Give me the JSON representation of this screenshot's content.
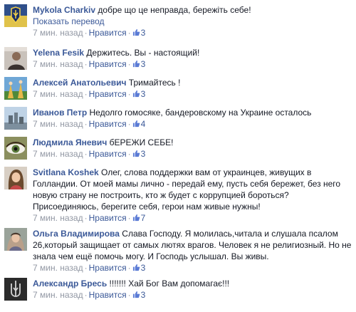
{
  "comments": [
    {
      "author": "Mykola Charkiv",
      "text": "добре що це неправда, бережіть себе!",
      "translate": "Показать перевод",
      "time": "7 мин. назад",
      "like": "Нравится",
      "count": "3"
    },
    {
      "author": "Yelena Fesik",
      "text": "Держитесь. Вы - настоящий!",
      "time": "7 мин. назад",
      "like": "Нравится",
      "count": "3"
    },
    {
      "author": "Алексей Анатольевич",
      "text": "Тримайтесь !",
      "time": "7 мин. назад",
      "like": "Нравится",
      "count": "3"
    },
    {
      "author": "Иванов Петр",
      "text": "Недолго гомосяке, бандеровскому на Украине осталось",
      "time": "7 мин. назад",
      "like": "Нравится",
      "count": "4"
    },
    {
      "author": "Людмила Яневич",
      "text": "бЕРЕЖИ СЕБЕ!",
      "time": "7 мин. назад",
      "like": "Нравится",
      "count": "3"
    },
    {
      "author": "Svitlana Koshek",
      "text": "Олег, слова поддержки вам от украинцев, живущих в Голландии. От моей мамы лично - передай ему, пусть себя бережет, без него новую страну не построить, кто ж будет с коррупцией бороться? Присоединяюсь, берегите себя, герои нам живые нужны!",
      "time": "7 мин. назад",
      "like": "Нравится",
      "count": "7"
    },
    {
      "author": "Ольга Владимирова",
      "text": "Слава Господу. Я молилась,читала и слушала псалом 26,который защищает от самых лютях врагов. Человек я не религиозный. Но не знала чем ещё помочь могу. И Господь услышал. Вы живы.",
      "time": "7 мин. назад",
      "like": "Нравится",
      "count": "3"
    },
    {
      "author": "Александр Бресь",
      "text": "!!!!!!! Хай Бог Вам допомагає!!!",
      "time": "7 мин. назад",
      "like": "Нравится",
      "count": "3"
    }
  ]
}
